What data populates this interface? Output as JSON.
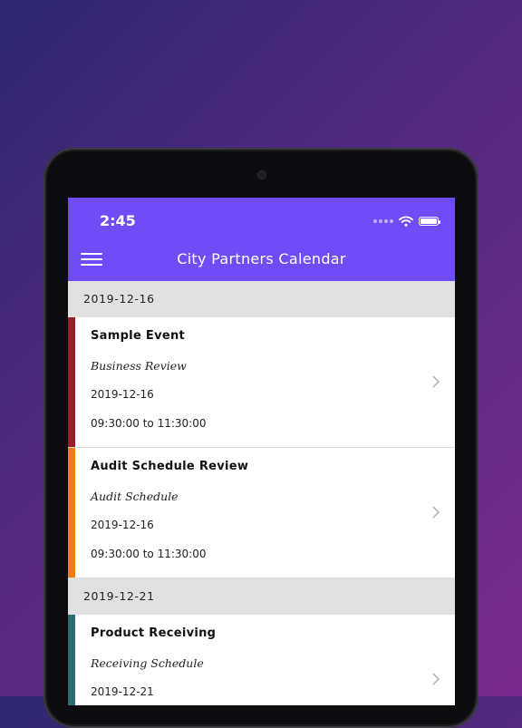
{
  "status_bar": {
    "time": "2:45"
  },
  "app_bar": {
    "title": "City Partners Calendar"
  },
  "colors": {
    "accent": "#6f4cf6",
    "red": "#9b1d2a",
    "orange": "#f57c14",
    "teal": "#2f6b75"
  },
  "sections": [
    {
      "date": "2019-12-16",
      "events": [
        {
          "title": "Sample Event",
          "category": "Business Review",
          "date": "2019-12-16",
          "time": "09:30:00 to 11:30:00",
          "color": "#9b1d2a"
        },
        {
          "title": "Audit Schedule Review",
          "category": "Audit Schedule",
          "date": "2019-12-16",
          "time": "09:30:00 to 11:30:00",
          "color": "#f57c14"
        }
      ]
    },
    {
      "date": "2019-12-21",
      "events": [
        {
          "title": "Product Receiving",
          "category": "Receiving Schedule",
          "date": "2019-12-21",
          "time": "",
          "color": "#2f6b75"
        }
      ]
    }
  ]
}
